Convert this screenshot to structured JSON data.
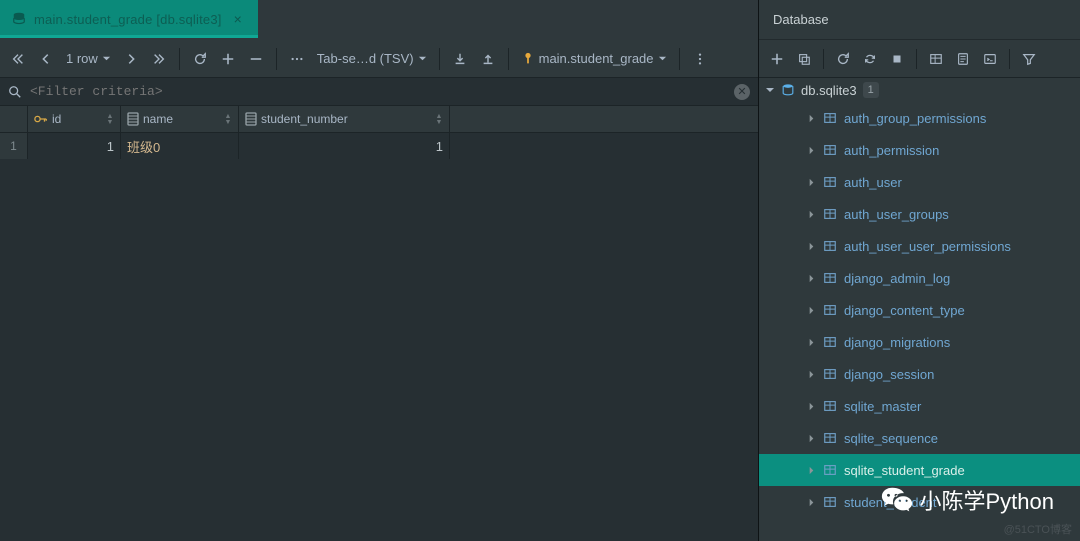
{
  "tab": {
    "title": "main.student_grade [db.sqlite3]"
  },
  "main_toolbar": {
    "rows_label": "1 row",
    "format_label": "Tab-se…d (TSV)",
    "schema_label": "main.student_grade"
  },
  "filter": {
    "placeholder": "<Filter criteria>"
  },
  "columns": {
    "id": "id",
    "name": "name",
    "student_number": "student_number"
  },
  "rows": [
    {
      "n": "1",
      "id": "1",
      "name": "班级0",
      "student_number": "1"
    }
  ],
  "side": {
    "title": "Database",
    "db_name": "db.sqlite3",
    "db_badge": "1",
    "tables": [
      "auth_group_permissions",
      "auth_permission",
      "auth_user",
      "auth_user_groups",
      "auth_user_user_permissions",
      "django_admin_log",
      "django_content_type",
      "django_migrations",
      "django_session",
      "sqlite_master",
      "sqlite_sequence",
      "sqlite_student_grade",
      "student_student"
    ],
    "selected_index": 11
  },
  "watermark": {
    "text": "小陈学Python",
    "sub": "@51CTO博客"
  }
}
